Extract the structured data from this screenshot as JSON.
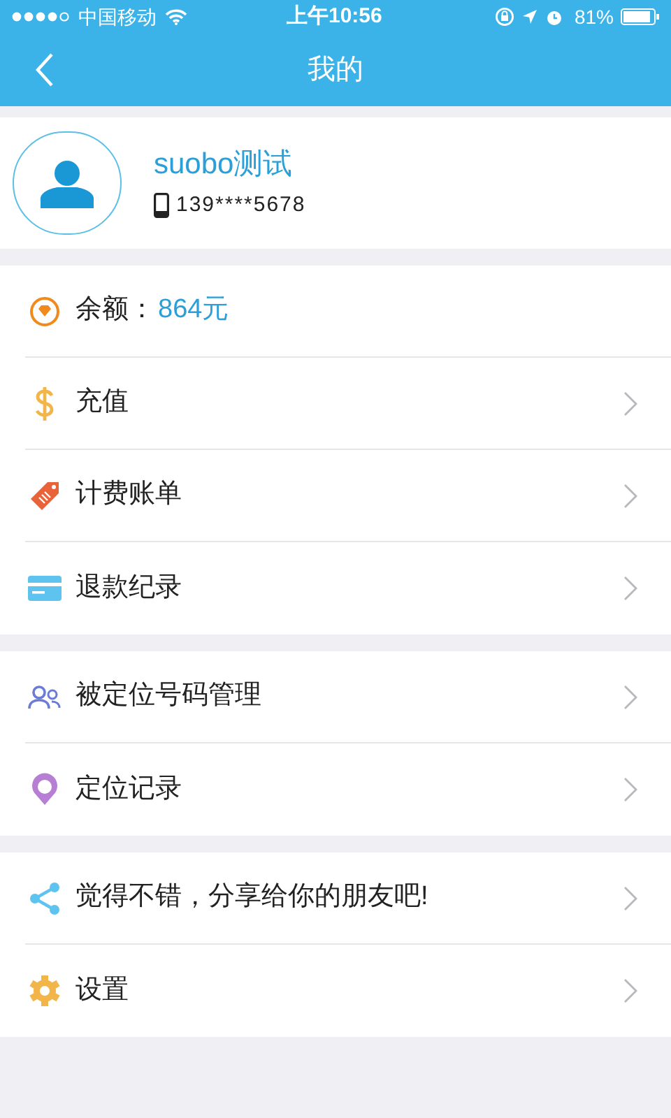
{
  "status_bar": {
    "carrier": "中国移动",
    "time": "上午10:56",
    "battery": "81%"
  },
  "nav": {
    "title": "我的"
  },
  "profile": {
    "name": "suobo测试",
    "phone": "139****5678"
  },
  "groups": [
    {
      "items": [
        {
          "kind": "balance",
          "label": "余额：",
          "value": "864元"
        },
        {
          "kind": "link",
          "label": "充值"
        },
        {
          "kind": "link",
          "label": "计费账单"
        },
        {
          "kind": "link",
          "label": "退款纪录"
        }
      ]
    },
    {
      "items": [
        {
          "kind": "link",
          "label": "被定位号码管理"
        },
        {
          "kind": "link",
          "label": "定位记录"
        }
      ]
    },
    {
      "items": [
        {
          "kind": "link",
          "label": "觉得不错，分享给你的朋友吧!"
        },
        {
          "kind": "link",
          "label": "设置"
        }
      ]
    }
  ]
}
